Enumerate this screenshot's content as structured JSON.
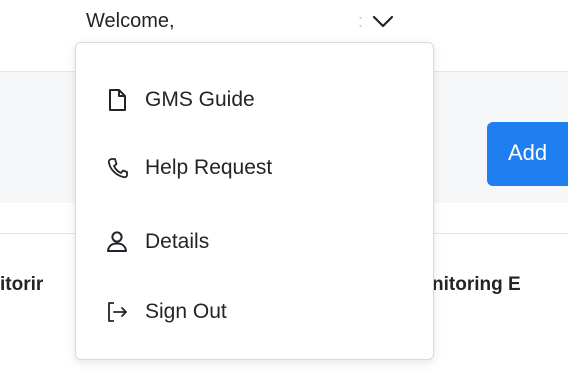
{
  "header": {
    "welcome_text": "Welcome,",
    "separator": ":",
    "user_menu_toggle_icon": "chevron-down-icon"
  },
  "page": {
    "add_button_label": "Add",
    "column_left_partial": "itorir",
    "column_right_partial": "nitoring E"
  },
  "menu": {
    "items": [
      {
        "label": "GMS Guide",
        "icon": "file-icon"
      },
      {
        "label": "Help Request",
        "icon": "phone-icon"
      },
      {
        "label": "Details",
        "icon": "user-icon"
      },
      {
        "label": "Sign Out",
        "icon": "sign-out-icon"
      }
    ]
  },
  "colors": {
    "accent": "#1f7ef0",
    "panel_background": "#f6f7f9",
    "menu_border": "#d9d9d9"
  }
}
